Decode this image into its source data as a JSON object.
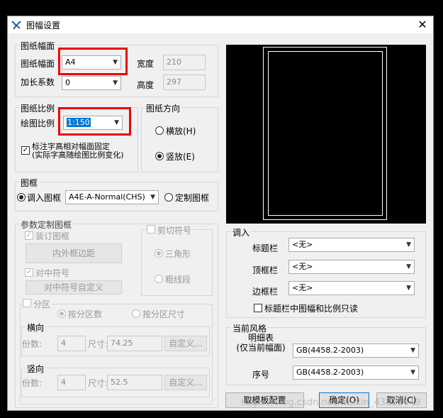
{
  "window": {
    "title": "图幅设置",
    "close_glyph": "✕"
  },
  "paper_size": {
    "group_label": "图纸幅面",
    "size_label": "图纸幅面",
    "size_value": "A4",
    "width_label": "宽度",
    "width_value": "210",
    "extend_label": "加长系数",
    "extend_value": "0",
    "height_label": "高度",
    "height_value": "297"
  },
  "scale": {
    "group_label": "图纸比例",
    "draw_scale_label": "绘图比例",
    "draw_scale_value": "1:150",
    "fix_text_label_line1": "标注字高相对幅面固定",
    "fix_text_label_line2": "(实际字高随绘图比例变化)",
    "fix_text_checked": true
  },
  "orientation": {
    "group_label": "图纸方向",
    "landscape_label": "横放(H)",
    "portrait_label": "竖放(E)",
    "selected": "portrait"
  },
  "frame": {
    "group_label": "图框",
    "load_label": "调入图框",
    "load_value": "A4E-A-Normal(CHS)",
    "custom_label": "定制图框",
    "selected": "load"
  },
  "custom_params": {
    "group_label": "参数定制图框",
    "binding_label": "装订图框",
    "margin_button": "内外框边距",
    "center_label": "对中符号",
    "center_button": "对中符号自定义",
    "trim_label": "剪切符号",
    "triangle_label": "三角形",
    "thick_label": "粗线段",
    "zone_label": "分区",
    "by_count_label": "按分区数",
    "by_size_label": "按分区尺寸",
    "horizontal_label": "横向",
    "vertical_label": "竖向",
    "count_label": "份数:",
    "size_label": "尺寸:",
    "custom_button": "自定义...",
    "h_count": "4",
    "h_size": "74.25",
    "v_count": "4",
    "v_size": "52.5"
  },
  "load_section": {
    "group_label": "调入",
    "title_bar_label": "标题栏",
    "title_bar_value": "<无>",
    "top_bar_label": "顶框栏",
    "top_bar_value": "<无>",
    "side_bar_label": "边框栏",
    "side_bar_value": "<无>",
    "readonly_label": "标题栏中图幅和比例只读"
  },
  "style_section": {
    "group_label": "当前风格",
    "detail_label_line1": "明细表",
    "detail_label_line2": "(仅当前幅面)",
    "detail_value": "GB(4458.2-2003)",
    "serial_label": "序号",
    "serial_value": "GB(4458.2-2003)"
  },
  "buttons": {
    "template": "取模板配置",
    "ok": "确定(O)",
    "cancel": "取消(C)"
  },
  "watermark": "https://blog.csdn.net/weixin_43822449",
  "colors": {
    "highlight_border": "#e00000",
    "selection": "#0078d7"
  }
}
